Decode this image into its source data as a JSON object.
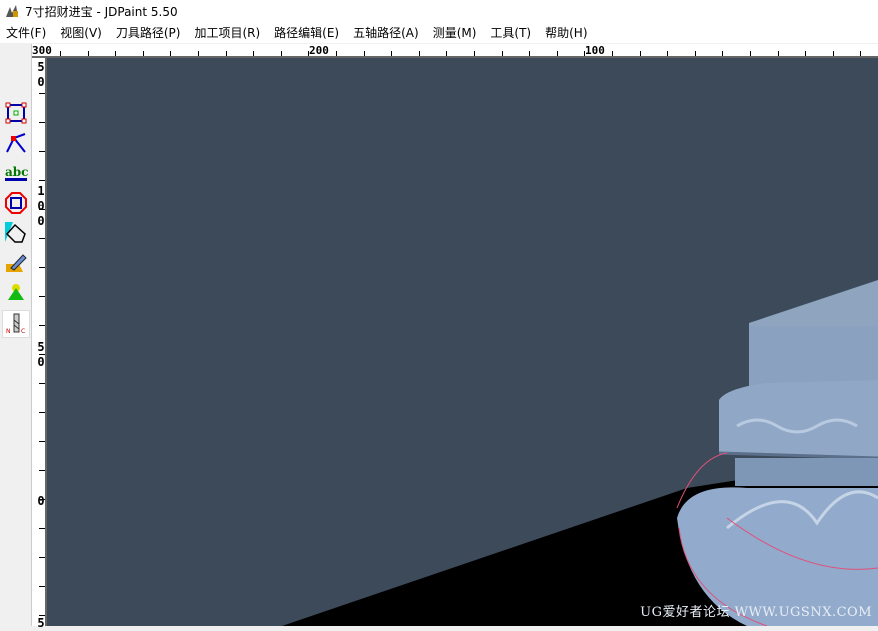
{
  "window": {
    "title": "7寸招财进宝 - JDPaint 5.50",
    "icon": "jdpaint-app-icon"
  },
  "menu": [
    "文件(F)",
    "视图(V)",
    "刀具路径(P)",
    "加工项目(R)",
    "路径编辑(E)",
    "五轴路径(A)",
    "测量(M)",
    "工具(T)",
    "帮助(H)"
  ],
  "top_ruler": {
    "labels": [
      "300",
      "200",
      "100"
    ]
  },
  "left_ruler": {
    "labels": [
      "5\n0",
      "1\n0\n0",
      "5\n0",
      "0",
      "5"
    ]
  },
  "toolbar": [
    "select-box-icon",
    "line-draw-icon",
    "text-abc-icon",
    "octagon-icon",
    "shape-fill-icon",
    "sculpt-tool-icon",
    "green-cone-icon",
    "nc-tool-icon"
  ],
  "viewport": {
    "background": "#3d4a5a",
    "floor": "#000000",
    "model_color": "#8fa6c2"
  },
  "watermark": "UG爱好者论坛 WWW.UGSNX.COM"
}
